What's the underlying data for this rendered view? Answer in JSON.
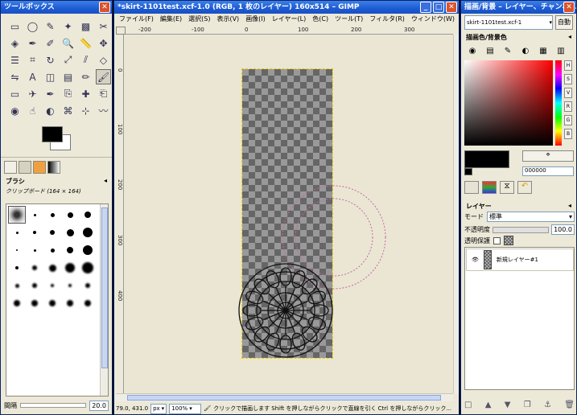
{
  "toolbox": {
    "title": "ツールボックス",
    "tools": [
      "rect-select-icon",
      "ellipse-select-icon",
      "lasso-icon",
      "fuzzy-select-icon",
      "color-select-icon",
      "scissors-icon",
      "foreground-select-icon",
      "paths-icon",
      "color-picker-icon",
      "zoom-icon",
      "measure-icon",
      "move-icon",
      "align-icon",
      "crop-icon",
      "rotate-icon",
      "scale-icon",
      "shear-icon",
      "perspective-icon",
      "flip-icon",
      "text-icon",
      "bucket-fill-icon",
      "blend-icon",
      "pencil-icon",
      "paintbrush-icon",
      "eraser-icon",
      "airbrush-icon",
      "ink-icon",
      "clone-icon",
      "heal-icon",
      "perspective-clone-icon",
      "blur-icon",
      "smudge-icon",
      "dodge-icon",
      "cage-icon",
      "unified-transform-icon",
      "warp-icon"
    ],
    "brush_panel": {
      "title": "ブラシ",
      "subtitle": "クリップボード (164 × 164)"
    },
    "bottom": {
      "label": "間隔",
      "value": "20.0"
    }
  },
  "image_window": {
    "title": "*skirt-1101test.xcf-1.0 (RGB, 1 枚のレイヤー) 160x514 – GIMP",
    "menu": [
      "ファイル(F)",
      "編集(E)",
      "選択(S)",
      "表示(V)",
      "画像(I)",
      "レイヤー(L)",
      "色(C)",
      "ツール(T)",
      "フィルタ(R)",
      "ウィンドウ(W)",
      "ヘルプ(H)"
    ],
    "ruler_h": [
      "-200",
      "-100",
      "0",
      "100",
      "200",
      "300"
    ],
    "ruler_v": [
      "0",
      "100",
      "200",
      "300",
      "400"
    ],
    "status": {
      "coords": "79.0, 431.0",
      "unit": "px",
      "zoom": "100%",
      "message": "クリックで描画します Shift を押しながらクリックで直線を引く Ctrl を押しながらクリック..."
    }
  },
  "layers_window": {
    "title": "描画/背景 – レイヤー、チャンネ...",
    "image_name": "skirt-1101test.xcf-1",
    "auto_label": "自動",
    "color_panel_title": "描画色/背景色",
    "channel_buttons": [
      "H",
      "S",
      "V",
      "R",
      "G",
      "B"
    ],
    "hex_value": "000000",
    "layers_panel": {
      "title": "レイヤー",
      "mode_label": "モード",
      "mode_value": "標準",
      "opacity_label": "不透明度",
      "opacity_value": "100.0",
      "lock_label": "透明保護",
      "layer_name": "新規レイヤー#1"
    }
  },
  "colors": {
    "titlebar": "#1c5bd3",
    "fg_color": "#000000",
    "bg_color": "#ffffff",
    "canvas": "#ebe6d4",
    "selection": "#e8d000"
  }
}
